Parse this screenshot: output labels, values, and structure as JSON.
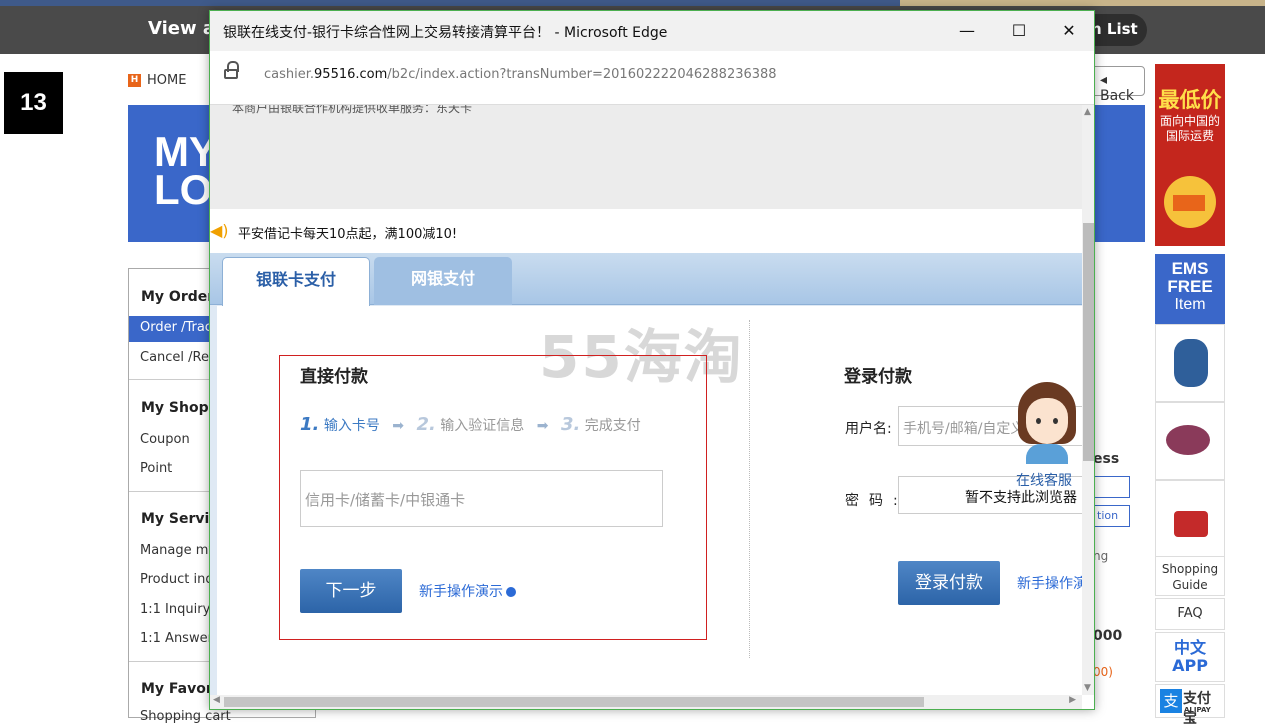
{
  "background": {
    "topbar_title": "View al",
    "wish_list": "h List",
    "slide_number": "13",
    "home_label": "HOME",
    "banner_text": "MY\nLO",
    "back_label": "Back",
    "sidebar": {
      "my_order": "My Order",
      "order_track": "Order /Trac",
      "cancel_return": "Cancel /Retu",
      "my_shopping": "My Shoppi",
      "coupon": "Coupon",
      "point": "Point",
      "my_service": "My Service",
      "manage": "Manage my",
      "product_inquiry": "Product inqu",
      "inquiry": "1:1 Inquiry",
      "answer": "1:1 Answer",
      "my_favorite": "My Favorit",
      "shopping_cart": "Shopping cart"
    },
    "right_fragments": {
      "ess": "ess",
      "tion": "tion",
      "ng": "ng",
      "amount": "000",
      "amount_sub": "00)"
    },
    "ads": {
      "lowest_price": "最低价",
      "to_china_1": "面向中国的",
      "to_china_2": "国际运费",
      "ems": "EMS",
      "free": "FREE",
      "item": "Item",
      "shopping_guide": "Shopping Guide",
      "faq": "FAQ",
      "chinese": "中文",
      "app": "APP",
      "alipay_cn": "支付宝",
      "alipay_en": "ALIPAY"
    }
  },
  "window": {
    "title": "银联在线支付-银行卡综合性网上交易转接清算平台！ - Microsoft Edge",
    "minimize": "—",
    "maximize": "☐",
    "close": "✕",
    "url_prefix": "cashier.",
    "url_domain": "95516.com",
    "url_path": "/b2c/index.action?transNumber=201602222046288236388"
  },
  "page": {
    "merchant_note": "本商户由银联合作机构提供收单服务：东天卡",
    "promo": "平安借记卡每天10点起，满100减10!",
    "tabs": [
      {
        "label": "银联卡支付",
        "active": true
      },
      {
        "label": "网银支付",
        "active": false
      }
    ],
    "watermark": "55海淘",
    "direct": {
      "title": "直接付款",
      "steps": [
        {
          "num": "1.",
          "label": "输入卡号"
        },
        {
          "num": "2.",
          "label": "输入验证信息"
        },
        {
          "num": "3.",
          "label": "完成支付"
        }
      ],
      "card_placeholder": "信用卡/储蓄卡/中银通卡",
      "next_button": "下一步",
      "demo_link": "新手操作演示"
    },
    "login": {
      "title": "登录付款",
      "user_label": "用户名:",
      "user_placeholder": "手机号/邮箱/自定义",
      "pw_label": "密码:",
      "pw_note": "暂不支持此浏览器",
      "login_button": "登录付款",
      "demo_link": "新手操作演"
    },
    "support_label": "在线客服"
  }
}
